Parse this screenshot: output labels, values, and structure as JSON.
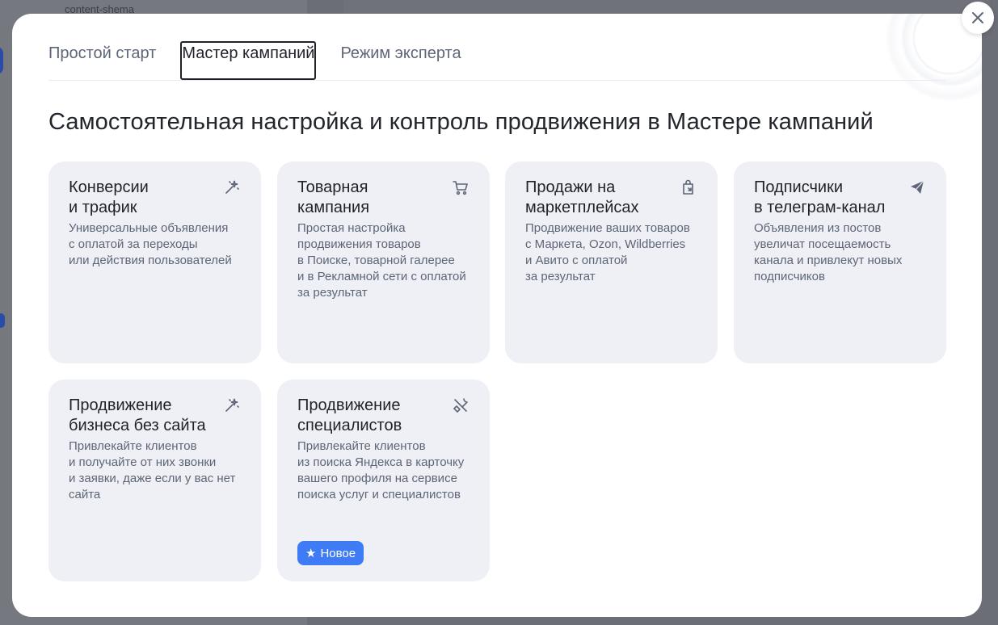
{
  "modal": {
    "tabs": [
      {
        "label": "Простой старт"
      },
      {
        "label": "Мастер кампаний"
      },
      {
        "label": "Режим эксперта"
      }
    ],
    "heading": "Самостоятельная настройка и контроль продвижения в Мастере кампаний",
    "cards": [
      {
        "title": "Конверсии\nи трафик",
        "description": "Универсальные объявления\nс оплатой за переходы\nили действия пользователей",
        "icon": "magic-wand-icon"
      },
      {
        "title": "Товарная\nкампания",
        "description": "Простая настройка\nпродвижения товаров\nв Поиске, товарной галерее\nи в Рекламной сети с оплатой\nза результат",
        "icon": "shopping-cart-icon"
      },
      {
        "title": "Продажи на\nмаркетплейсах",
        "description": "Продвижение ваших товаров\nс Маркета, Ozon, Wildberries\nи Авито с оплатой\nза результат",
        "icon": "shopping-bag-icon"
      },
      {
        "title": "Подписчики\nв телеграм-канал",
        "description": "Объявления из постов\nувеличат посещаемость\nканала и привлекут новых\nподписчиков",
        "icon": "telegram-plane-icon"
      },
      {
        "title": "Продвижение\nбизнеса без сайта",
        "description": "Привлекайте клиентов\nи получайте от них звонки\nи заявки, даже если у вас нет\nсайта",
        "icon": "magic-wand-icon"
      },
      {
        "title": "Продвижение\nспециалистов",
        "description": "Привлекайте клиентов\nиз поиска Яндекса в карточку\nвашего профиля на сервисе\nпоиска услуг и специалистов",
        "icon": "tools-icon",
        "badge": "Новое"
      }
    ],
    "badge_color": "#3e7bf5"
  },
  "background": {
    "snippet": "content-shema"
  }
}
